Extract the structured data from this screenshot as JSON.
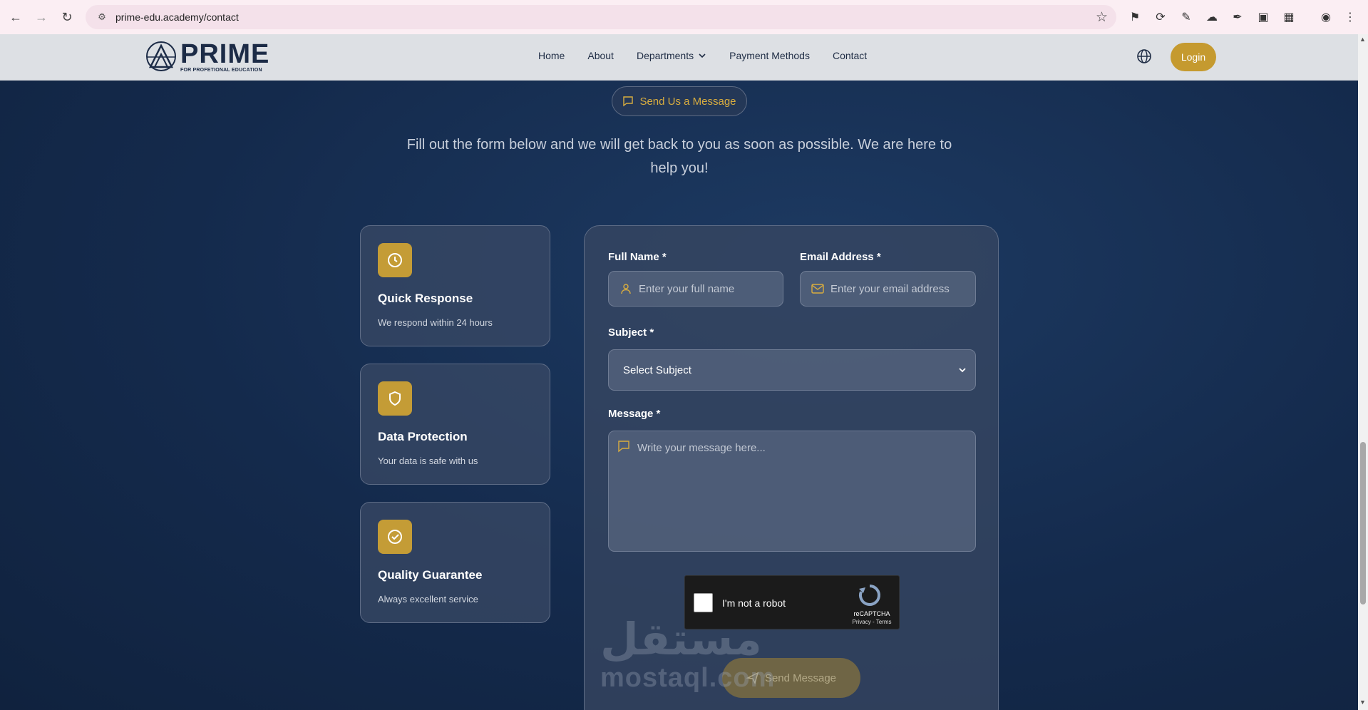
{
  "browser": {
    "url": "prime-edu.academy/contact"
  },
  "header": {
    "logo_title": "PRIME",
    "logo_subtitle": "FOR PROFETIONAL EDUCATION",
    "nav": [
      {
        "label": "Home"
      },
      {
        "label": "About"
      },
      {
        "label": "Departments"
      },
      {
        "label": "Payment Methods"
      },
      {
        "label": "Contact"
      }
    ],
    "login_label": "Login"
  },
  "hero": {
    "pill_label": "Send Us a Message",
    "intro": "Fill out the form below and we will get back to you as soon as possible. We are here to help you!"
  },
  "features": [
    {
      "title": "Quick Response",
      "desc": "We respond within 24 hours",
      "icon": "clock-icon"
    },
    {
      "title": "Data Protection",
      "desc": "Your data is safe with us",
      "icon": "shield-icon"
    },
    {
      "title": "Quality Guarantee",
      "desc": "Always excellent service",
      "icon": "check-circle-icon"
    }
  ],
  "form": {
    "full_name_label": "Full Name *",
    "full_name_placeholder": "Enter your full name",
    "email_label": "Email Address *",
    "email_placeholder": "Enter your email address",
    "subject_label": "Subject *",
    "subject_value": "Select Subject",
    "message_label": "Message *",
    "message_placeholder": "Write your message here...",
    "captcha_text": "I'm not a robot",
    "captcha_brand": "reCAPTCHA",
    "captcha_terms": "Privacy - Terms",
    "send_label": "Send Message"
  },
  "watermark": {
    "arabic": "مستقل",
    "latin": "mostaql.com"
  },
  "colors": {
    "accent_gold": "#c59a2f",
    "bg_navy": "#13284a"
  }
}
